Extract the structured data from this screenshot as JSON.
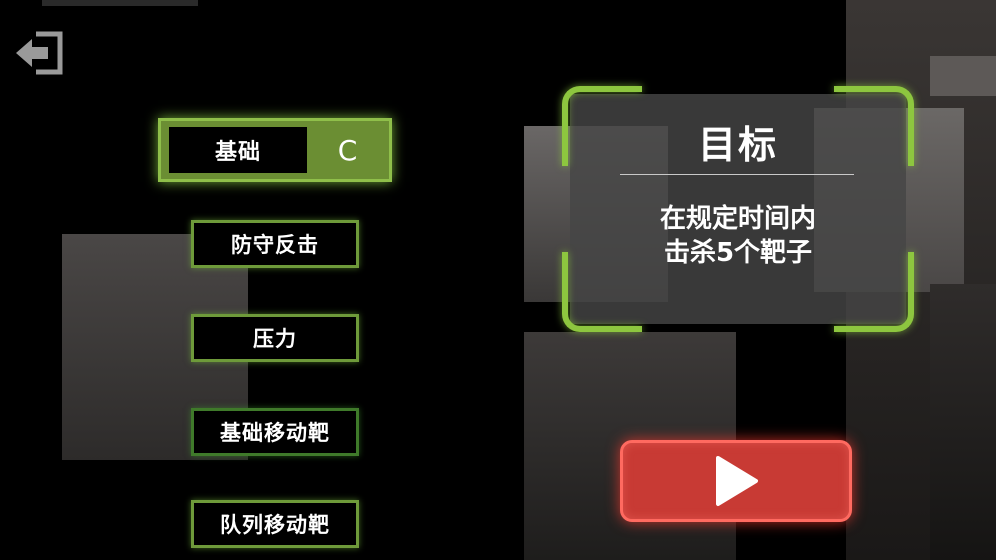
{
  "modes": {
    "selected": {
      "label": "基础",
      "grade": "C"
    },
    "list": [
      {
        "label": "防守反击"
      },
      {
        "label": "压力"
      },
      {
        "label": "基础移动靶"
      },
      {
        "label": "队列移动靶"
      }
    ]
  },
  "objective": {
    "title": "目标",
    "line1": "在规定时间内",
    "line2": "击杀5个靶子"
  },
  "icons": {
    "back": "exit-door-icon",
    "play": "play-triangle-icon"
  },
  "colors": {
    "accent_green": "#8dc63f",
    "play_red": "#c83a34"
  }
}
